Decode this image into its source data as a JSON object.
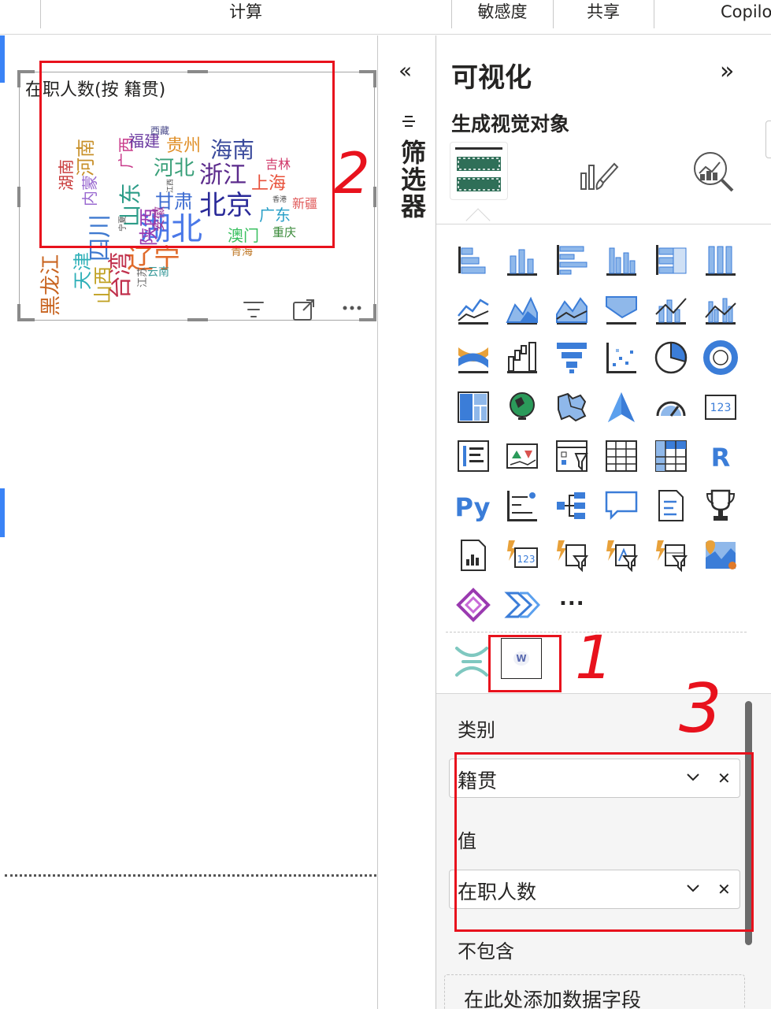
{
  "ribbon": {
    "items": [
      "计算",
      "敏感度",
      "共享",
      "Copilot"
    ]
  },
  "canvas": {
    "visual_title": "在职人数(按 籍贯)",
    "wordcloud": [
      {
        "text": "湖北",
        "size": 40,
        "color": "#4a78e8"
      },
      {
        "text": "北京",
        "size": 34,
        "color": "#2a2a99"
      },
      {
        "text": "浙江",
        "size": 30,
        "color": "#5b2a8c"
      },
      {
        "text": "辽宁",
        "size": 34,
        "color": "#e06a2a"
      },
      {
        "text": "台湾",
        "size": 30,
        "color": "#c0304c"
      },
      {
        "text": "四川",
        "size": 30,
        "color": "#3f7ad0"
      },
      {
        "text": "山东",
        "size": 28,
        "color": "#2c9c88"
      },
      {
        "text": "黑龙江",
        "size": 26,
        "color": "#c86420"
      },
      {
        "text": "天津",
        "size": 24,
        "color": "#2fb0b8"
      },
      {
        "text": "山西",
        "size": 24,
        "color": "#c0a020"
      },
      {
        "text": "海南",
        "size": 28,
        "color": "#3a4a9c"
      },
      {
        "text": "河北",
        "size": 26,
        "color": "#3aa07a"
      },
      {
        "text": "甘肃",
        "size": 24,
        "color": "#3a6ad0"
      },
      {
        "text": "陕西",
        "size": 24,
        "color": "#9a3ab0"
      },
      {
        "text": "贵州",
        "size": 22,
        "color": "#e0902a"
      },
      {
        "text": "上海",
        "size": 22,
        "color": "#e8503a"
      },
      {
        "text": "河南",
        "size": 24,
        "color": "#c8902a"
      },
      {
        "text": "湖南",
        "size": 20,
        "color": "#c83a3a"
      },
      {
        "text": "内蒙",
        "size": 20,
        "color": "#9a6ad0"
      },
      {
        "text": "广西",
        "size": 20,
        "color": "#c83a8a"
      },
      {
        "text": "福建",
        "size": 20,
        "color": "#6a3aa0"
      },
      {
        "text": "广东",
        "size": 20,
        "color": "#2aa0c8"
      },
      {
        "text": "澳门",
        "size": 20,
        "color": "#3ac060"
      },
      {
        "text": "安徽",
        "size": 16,
        "color": "#a03a9a"
      },
      {
        "text": "吉林",
        "size": 16,
        "color": "#d03a6a"
      },
      {
        "text": "新疆",
        "size": 16,
        "color": "#e05a5a"
      },
      {
        "text": "重庆",
        "size": 15,
        "color": "#3a8a3a"
      },
      {
        "text": "青海",
        "size": 14,
        "color": "#c07a2a"
      },
      {
        "text": "云南",
        "size": 14,
        "color": "#3a9a9a"
      },
      {
        "text": "江苏",
        "size": 13,
        "color": "#6a6a6a"
      },
      {
        "text": "西藏",
        "size": 12,
        "color": "#4a4a8a"
      },
      {
        "text": "宁夏",
        "size": 10,
        "color": "#4a4a4a"
      },
      {
        "text": "江西",
        "size": 9,
        "color": "#4a4a4a"
      },
      {
        "text": "香港",
        "size": 9,
        "color": "#4a4a4a"
      }
    ]
  },
  "filters": {
    "collapse_icon": "double-chevron-left-icon",
    "label": "筛选器"
  },
  "viz": {
    "title": "可视化",
    "expand_icon": "double-chevron-right-icon",
    "subtitle": "生成视觉对象",
    "more": "...",
    "fields": {
      "category_label": "类别",
      "category_value": "籍贯",
      "value_label": "值",
      "value_value": "在职人数",
      "exclude_label": "不包含",
      "exclude_placeholder": "在此处添加数据字段"
    },
    "custom_visual_letter": "W"
  },
  "annotations": {
    "one": "1",
    "two": "2",
    "three": "3"
  },
  "colors": {
    "accent_blue": "#3a83f6",
    "annotation_red": "#e8121d",
    "icon_blue": "#3b7dd8"
  }
}
